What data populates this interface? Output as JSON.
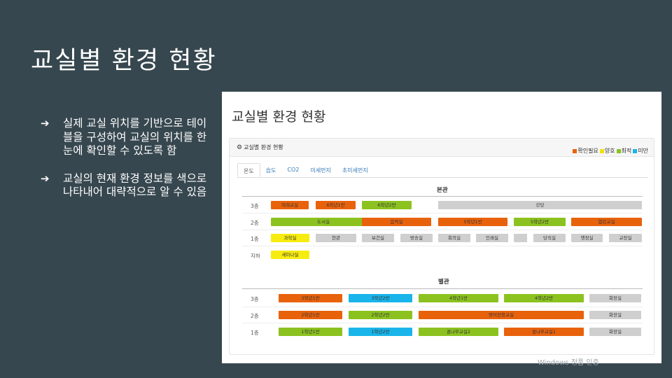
{
  "slide": {
    "title": "교실별 환경 현황",
    "bullets": [
      {
        "arrow": "➔",
        "text": "실제 교실 위치를 기반으로 테이블을 구성하여 교실의 위치를 한눈에 확인할 수 있도록 함"
      },
      {
        "arrow": "➔",
        "text": "교실의 현재 환경 정보를 색으로 나타내어 대략적으로 알 수 있음"
      }
    ]
  },
  "screenshot": {
    "title": "교실별 환경 현황",
    "panel_title": "교실별 환경 현황",
    "panel_icon": "cog-icon",
    "legend": [
      {
        "label": "확인필요",
        "color": "#e8620c"
      },
      {
        "label": "양호",
        "color": "#f2e20b"
      },
      {
        "label": "최적",
        "color": "#8cc21f"
      },
      {
        "label": "미만",
        "color": "#19b5ea"
      }
    ],
    "tabs": [
      "온도",
      "습도",
      "CO2",
      "미세먼지",
      "초미세먼지"
    ],
    "active_tab": "온도",
    "status_colors": {
      "orange": "#e8620c",
      "yellow": "#f7ec0f",
      "green": "#8cc21f",
      "blue": "#19b5ea",
      "gray": "#cfcfcf"
    },
    "main_building": {
      "title": "본관",
      "floors": [
        {
          "label": "3층",
          "rooms": [
            {
              "name": "미래교실",
              "status": "orange"
            },
            {
              "name": "6학년1반",
              "status": "orange"
            },
            {
              "name": "6학년2반",
              "status": "green"
            },
            {
              "name": "강당",
              "status": "gray"
            }
          ]
        },
        {
          "label": "2층",
          "rooms": [
            {
              "name": "도서실",
              "status": "green"
            },
            {
              "name": "음악실",
              "status": "orange"
            },
            {
              "name": "5학년1반",
              "status": "orange"
            },
            {
              "name": "5학년2반",
              "status": "green"
            },
            {
              "name": "열린교실",
              "status": "orange"
            }
          ]
        },
        {
          "label": "1층",
          "rooms": [
            {
              "name": "과학실",
              "status": "yellow"
            },
            {
              "name": "현관",
              "status": "gray"
            },
            {
              "name": "보건실",
              "status": "gray"
            },
            {
              "name": "방송실",
              "status": "gray"
            },
            {
              "name": "회의실",
              "status": "gray"
            },
            {
              "name": "인쇄실",
              "status": "gray"
            },
            {
              "name": "",
              "status": "gray"
            },
            {
              "name": "당직실",
              "status": "gray"
            },
            {
              "name": "행정실",
              "status": "gray"
            },
            {
              "name": "교장실",
              "status": "gray"
            }
          ]
        },
        {
          "label": "지하",
          "rooms": [
            {
              "name": "세미나실",
              "status": "yellow"
            }
          ]
        }
      ]
    },
    "annex_building": {
      "title": "별관",
      "floors": [
        {
          "label": "3층",
          "rooms": [
            {
              "name": "3학년1반",
              "status": "orange"
            },
            {
              "name": "3학년2반",
              "status": "blue"
            },
            {
              "name": "4학년1반",
              "status": "green"
            },
            {
              "name": "4학년2반",
              "status": "green"
            },
            {
              "name": "화장실",
              "status": "gray"
            }
          ]
        },
        {
          "label": "2층",
          "rooms": [
            {
              "name": "2학년1반",
              "status": "orange"
            },
            {
              "name": "2학년2반",
              "status": "green"
            },
            {
              "name": "영어전용교실",
              "status": "orange"
            },
            {
              "name": "화장실",
              "status": "gray"
            }
          ]
        },
        {
          "label": "1층",
          "rooms": [
            {
              "name": "1학년1반",
              "status": "green"
            },
            {
              "name": "1학년2반",
              "status": "blue"
            },
            {
              "name": "꿈나무교실2",
              "status": "green"
            },
            {
              "name": "꿈나무교실1",
              "status": "orange"
            },
            {
              "name": "화장실",
              "status": "gray"
            }
          ]
        }
      ]
    }
  },
  "watermark": "Windows 정품 인증"
}
